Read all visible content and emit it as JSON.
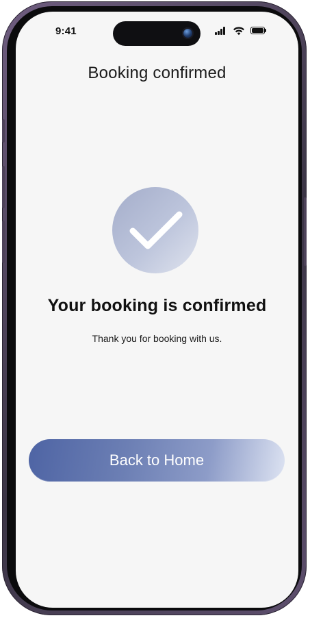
{
  "status_bar": {
    "time": "9:41",
    "icons": [
      "signal-icon",
      "wifi-icon",
      "battery-icon"
    ]
  },
  "header": {
    "title": "Booking confirmed"
  },
  "confirmation": {
    "icon": "checkmark-icon",
    "heading": "Your booking is confirmed",
    "message": "Thank you for booking with us."
  },
  "actions": {
    "back_home_label": "Back to Home"
  },
  "colors": {
    "screen_bg": "#f6f6f6",
    "button_gradient_start": "#4e64a4",
    "button_gradient_end": "#dde3f2",
    "check_circle": "#b8c0d8",
    "text_primary": "#111111"
  }
}
